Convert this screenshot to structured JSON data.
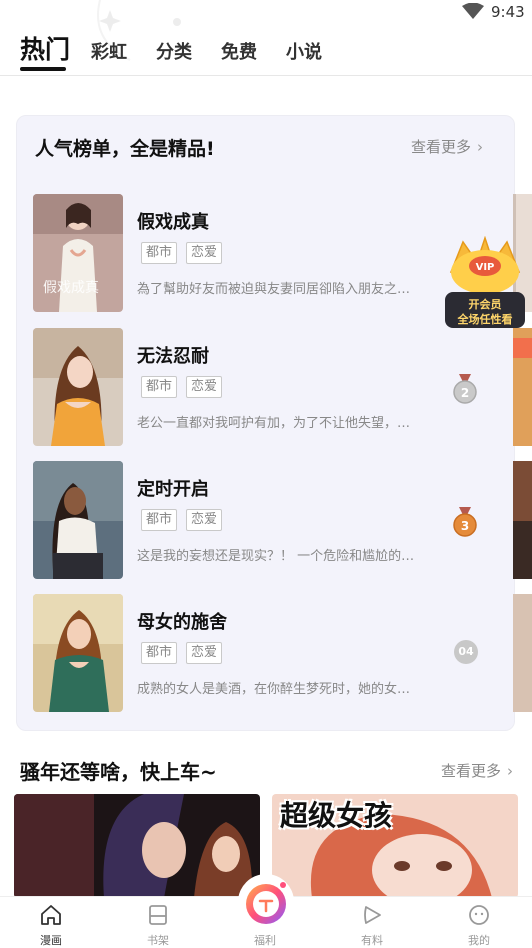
{
  "status": {
    "time": "9:43"
  },
  "tabs": [
    {
      "label": "热门",
      "active": true
    },
    {
      "label": "彩虹"
    },
    {
      "label": "分类"
    },
    {
      "label": "免费"
    },
    {
      "label": "小说"
    }
  ],
  "ranking": {
    "title": "人气榜单，全是精品!",
    "more": "查看更多",
    "items": [
      {
        "title": "假戏成真",
        "tags": [
          "都市",
          "恋爱"
        ],
        "desc": "為了幫助好友而被迫與友妻同居卻陷入朋友之…",
        "rank": "1"
      },
      {
        "title": "无法忍耐",
        "tags": [
          "都市",
          "恋爱"
        ],
        "desc": "老公一直都对我呵护有加，为了不让他失望，…",
        "rank": "2"
      },
      {
        "title": "定时开启",
        "tags": [
          "都市",
          "恋爱"
        ],
        "desc": "这是我的妄想还是现实？！ 一个危险和尴尬的…",
        "rank": "3"
      },
      {
        "title": "母女的施舍",
        "tags": [
          "都市",
          "恋爱"
        ],
        "desc": "成熟的女人是美酒，在你醉生梦死时，她的女…",
        "rank": "04"
      }
    ]
  },
  "vip_badge": {
    "line1": "开会员",
    "line2": "全场任性看",
    "crown": "VIP"
  },
  "section2": {
    "title": "骚年还等啥，快上车~",
    "more": "查看更多",
    "banner_text": "超级女孩"
  },
  "nav": [
    {
      "label": "漫画",
      "icon": "home-icon",
      "active": true
    },
    {
      "label": "书架",
      "icon": "bookshelf-icon"
    },
    {
      "label": "福利",
      "icon": "gift-icon"
    },
    {
      "label": "有料",
      "icon": "play-icon"
    },
    {
      "label": "我的",
      "icon": "profile-icon"
    }
  ],
  "colors": {
    "accent": "#ff4f7b",
    "vip_gold": "#f7b93a",
    "text_gray": "#888888"
  }
}
